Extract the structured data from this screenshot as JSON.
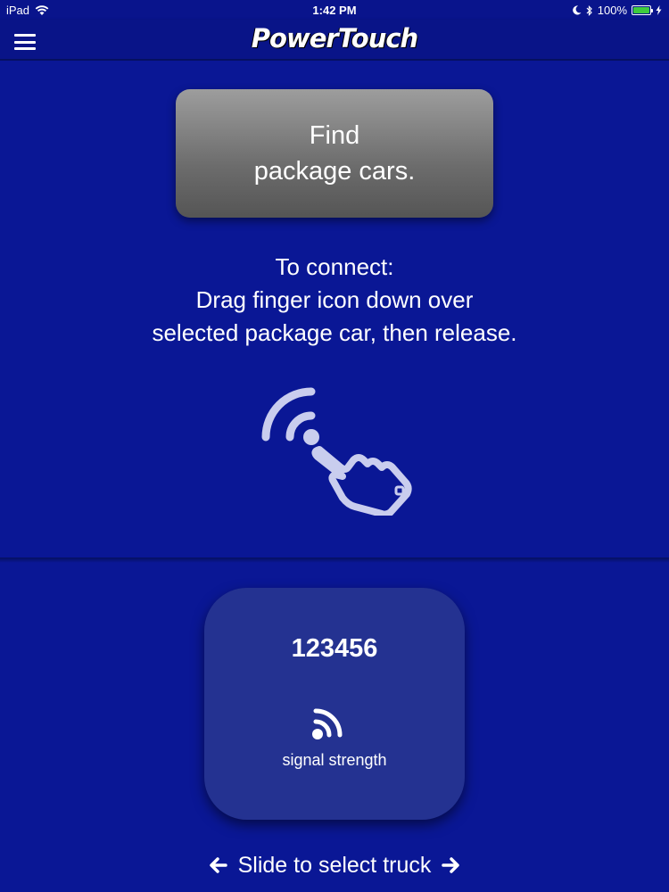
{
  "status_bar": {
    "device": "iPad",
    "time": "1:42 PM",
    "battery": "100%",
    "icons": [
      "wifi-icon",
      "moon-icon",
      "bluetooth-icon",
      "battery-icon",
      "charging-icon"
    ]
  },
  "header": {
    "menu_icon": "hamburger-menu-icon",
    "logo": "PowerTouch"
  },
  "find_button": {
    "line1": "Find",
    "line2": "package cars."
  },
  "instructions": {
    "line1": "To connect:",
    "line2": "Drag finger icon down over",
    "line3": "selected package car, then release.",
    "icon": "drag-finger-wireless-icon"
  },
  "truck_card": {
    "id": "123456",
    "signal_icon": "signal-strength-icon",
    "signal_label": "signal strength"
  },
  "footer": {
    "label": "Slide to select truck",
    "left_icon": "arrow-left-icon",
    "right_icon": "arrow-right-icon"
  },
  "colors": {
    "background": "#0a1795",
    "card": "#243291",
    "button_gray": "#7a7a7a",
    "battery_green": "#3ecb3e"
  }
}
